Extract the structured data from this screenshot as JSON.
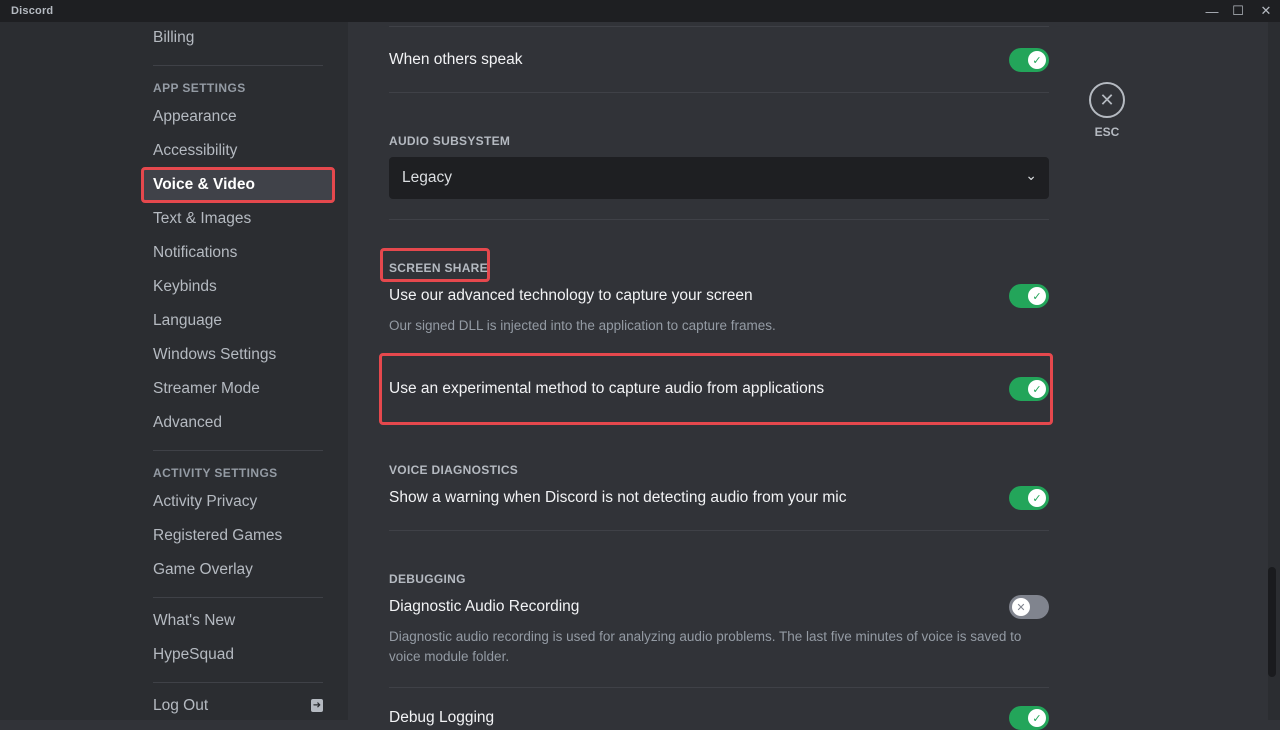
{
  "window": {
    "title": "Discord",
    "controls": {
      "minimize": "—",
      "maximize": "☐",
      "close": "✕"
    }
  },
  "sidebar": {
    "items": [
      {
        "label": "Billing"
      },
      {
        "header": "APP SETTINGS"
      },
      {
        "label": "Appearance"
      },
      {
        "label": "Accessibility"
      },
      {
        "label": "Voice & Video",
        "active": true
      },
      {
        "label": "Text & Images"
      },
      {
        "label": "Notifications"
      },
      {
        "label": "Keybinds"
      },
      {
        "label": "Language"
      },
      {
        "label": "Windows Settings"
      },
      {
        "label": "Streamer Mode"
      },
      {
        "label": "Advanced"
      },
      {
        "header": "ACTIVITY SETTINGS"
      },
      {
        "label": "Activity Privacy"
      },
      {
        "label": "Registered Games"
      },
      {
        "label": "Game Overlay"
      },
      {
        "label": "What's New"
      },
      {
        "label": "HypeSquad"
      },
      {
        "label": "Log Out",
        "icon": "logout-icon"
      }
    ],
    "billing": "Billing",
    "app_settings_header": "APP SETTINGS",
    "appearance": "Appearance",
    "accessibility": "Accessibility",
    "voice_video": "Voice & Video",
    "text_images": "Text & Images",
    "notifications": "Notifications",
    "keybinds": "Keybinds",
    "language": "Language",
    "windows_settings": "Windows Settings",
    "streamer_mode": "Streamer Mode",
    "advanced": "Advanced",
    "activity_settings_header": "ACTIVITY SETTINGS",
    "activity_privacy": "Activity Privacy",
    "registered_games": "Registered Games",
    "game_overlay": "Game Overlay",
    "whats_new": "What's New",
    "hypesquad": "HypeSquad",
    "log_out": "Log Out",
    "log_out_icon": "➜"
  },
  "content": {
    "when_others_speak": {
      "label": "When others speak",
      "enabled": true
    },
    "audio_subsystem": {
      "title": "AUDIO SUBSYSTEM",
      "selected": "Legacy",
      "chevron": "⌄"
    },
    "screen_share": {
      "title": "SCREEN SHARE",
      "advanced_capture": {
        "label": "Use our advanced technology to capture your screen",
        "description": "Our signed DLL is injected into the application to capture frames.",
        "enabled": true
      },
      "experimental_audio": {
        "label": "Use an experimental method to capture audio from applications",
        "enabled": true
      }
    },
    "voice_diagnostics": {
      "title": "VOICE DIAGNOSTICS",
      "mic_warning": {
        "label": "Show a warning when Discord is not detecting audio from your mic",
        "enabled": true
      }
    },
    "debugging": {
      "title": "DEBUGGING",
      "diagnostic_audio": {
        "label": "Diagnostic Audio Recording",
        "description": "Diagnostic audio recording is used for analyzing audio problems. The last five minutes of voice is saved to voice module folder.",
        "enabled": false
      },
      "debug_logging": {
        "label": "Debug Logging",
        "enabled": true
      }
    },
    "toggle_on_glyph": "✓",
    "toggle_off_glyph": "✕"
  },
  "esc": {
    "icon": "✕",
    "label": "ESC"
  },
  "colors": {
    "accent_green": "#23a55a",
    "highlight_red": "#e5484d",
    "toggle_off": "#80848e"
  }
}
